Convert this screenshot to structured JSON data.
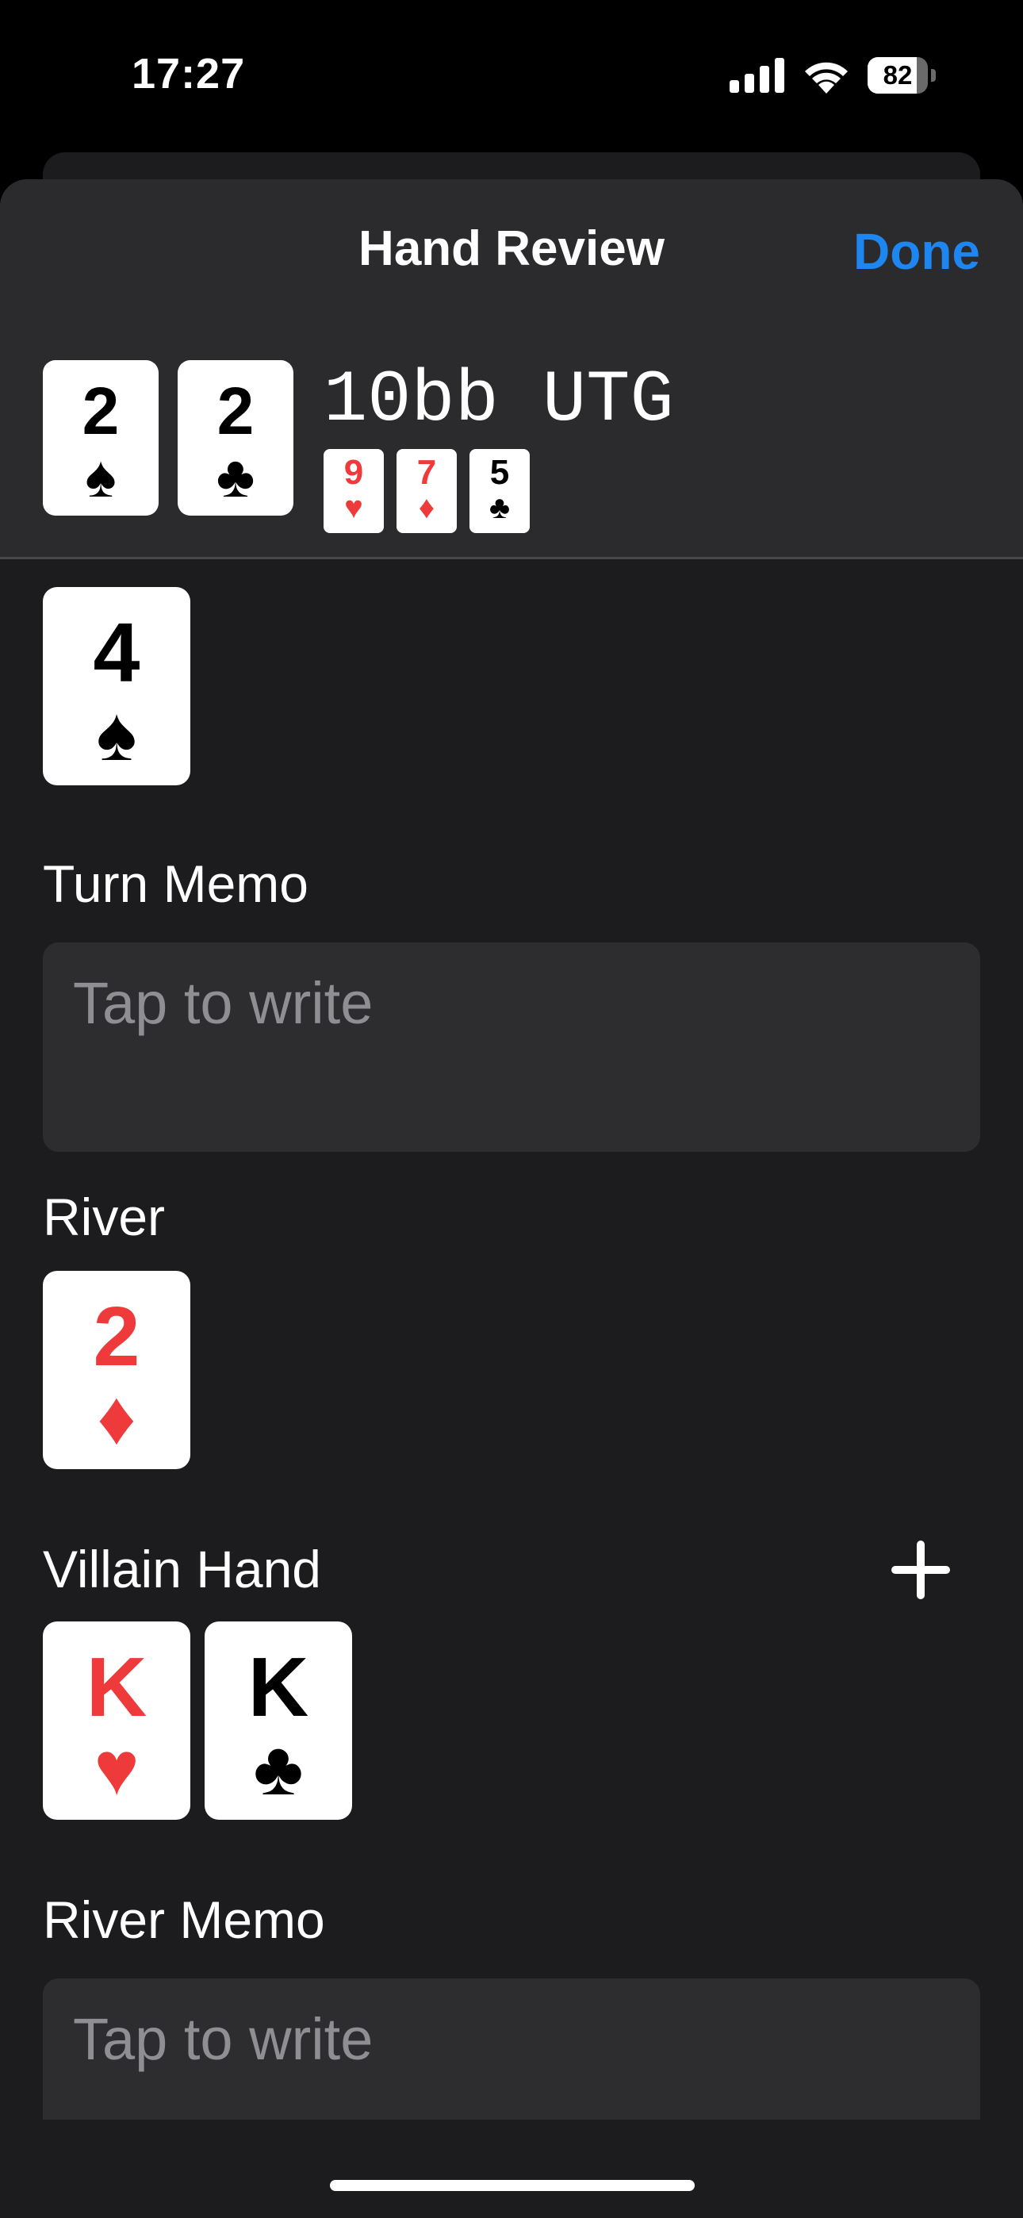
{
  "status_bar": {
    "time": "17:27",
    "battery_level": "82",
    "icons": [
      "signal-icon",
      "wifi-icon",
      "battery-icon"
    ]
  },
  "nav": {
    "title": "Hand Review",
    "done_label": "Done",
    "done_color": "#1e86f0"
  },
  "hand": {
    "title": "10bb UTG",
    "hero_cards": [
      {
        "rank": "2",
        "suit": "♠",
        "color": "black"
      },
      {
        "rank": "2",
        "suit": "♣",
        "color": "black"
      }
    ],
    "flop_cards": [
      {
        "rank": "9",
        "suit": "♥",
        "color": "red"
      },
      {
        "rank": "7",
        "suit": "♦",
        "color": "red"
      },
      {
        "rank": "5",
        "suit": "♣",
        "color": "black"
      }
    ]
  },
  "turn": {
    "card": {
      "rank": "4",
      "suit": "♠",
      "color": "black"
    },
    "memo_label": "Turn Memo",
    "memo_placeholder": "Tap to write"
  },
  "river": {
    "label": "River",
    "card": {
      "rank": "2",
      "suit": "♦",
      "color": "red"
    }
  },
  "villain": {
    "label": "Villain Hand",
    "add_icon": "plus-icon",
    "cards": [
      {
        "rank": "K",
        "suit": "♥",
        "color": "red"
      },
      {
        "rank": "K",
        "suit": "♣",
        "color": "black"
      }
    ]
  },
  "river_memo": {
    "label": "River Memo",
    "placeholder": "Tap to write"
  },
  "colors": {
    "red_suit": "#ee3a3a",
    "black_suit": "#000000",
    "accent": "#1e86f0"
  }
}
